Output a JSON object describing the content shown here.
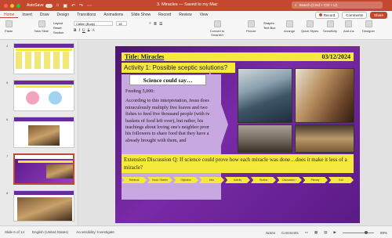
{
  "titlebar": {
    "autosave_label": "AutoSave",
    "doc_title": "3. Miracles — Saved to my Mac",
    "search_placeholder": "Search (Cmd + Ctrl + U)"
  },
  "menu": {
    "tabs": [
      "Home",
      "Insert",
      "Draw",
      "Design",
      "Transitions",
      "Animations",
      "Slide Show",
      "Record",
      "Review",
      "View"
    ],
    "active_tab": "Home",
    "record_label": "Record",
    "comments_label": "Comments",
    "share_label": "Share"
  },
  "ribbon": {
    "paste_label": "Paste",
    "new_slide_label": "New Slide",
    "layout_label": "Layout",
    "reset_label": "Reset",
    "section_label": "Section",
    "font_name": "Calibri (Body)",
    "font_size": "18",
    "convert_label": "Convert to SmartArt",
    "picture_label": "Picture",
    "shapes_label": "Shapes",
    "textbox_label": "Text Box",
    "arrange_label": "Arrange",
    "quick_styles_label": "Quick Styles",
    "sensitivity_label": "Sensitivity",
    "addins_label": "Add-ins",
    "designer_label": "Designer"
  },
  "thumbnails": [
    "4",
    "5",
    "6",
    "7",
    "8"
  ],
  "slide": {
    "title": "Title:  Miracles",
    "date": "03/12/2024",
    "activity": "Activity 1: Possible sceptic solutions?",
    "science_heading": "Science could say…",
    "body_lead": "Feeding 5,000:",
    "body_text": "According to this interpretation, Jesus does not miraculously multiply five loaves and two fishes to feed five thousand people (with twelve baskets of food left over), but rather, his teachings about loving one's neighbor prompts his followers to share food that they have all already brought with them, and",
    "extension": "Extension Discussion Q: If science could prove how each miracle was done…does it make it less of a miracle?",
    "nav_items": [
      "Retrieval",
      "Hook / Starter",
      "Objective",
      "Intro",
      "Activity",
      "Review",
      "Discussion / Reflection",
      "Plenary",
      "Exit"
    ]
  },
  "status": {
    "slide_of": "Slide 6 of 14",
    "language": "English (United States)",
    "accessibility": "Accessibility: Investigate",
    "notes": "Notes",
    "comments": "Comments",
    "zoom": "89%"
  },
  "colors": {
    "brand": "#c4482f",
    "slide_purple": "#6a2a9a",
    "highlight_yellow": "#f5e93b"
  }
}
